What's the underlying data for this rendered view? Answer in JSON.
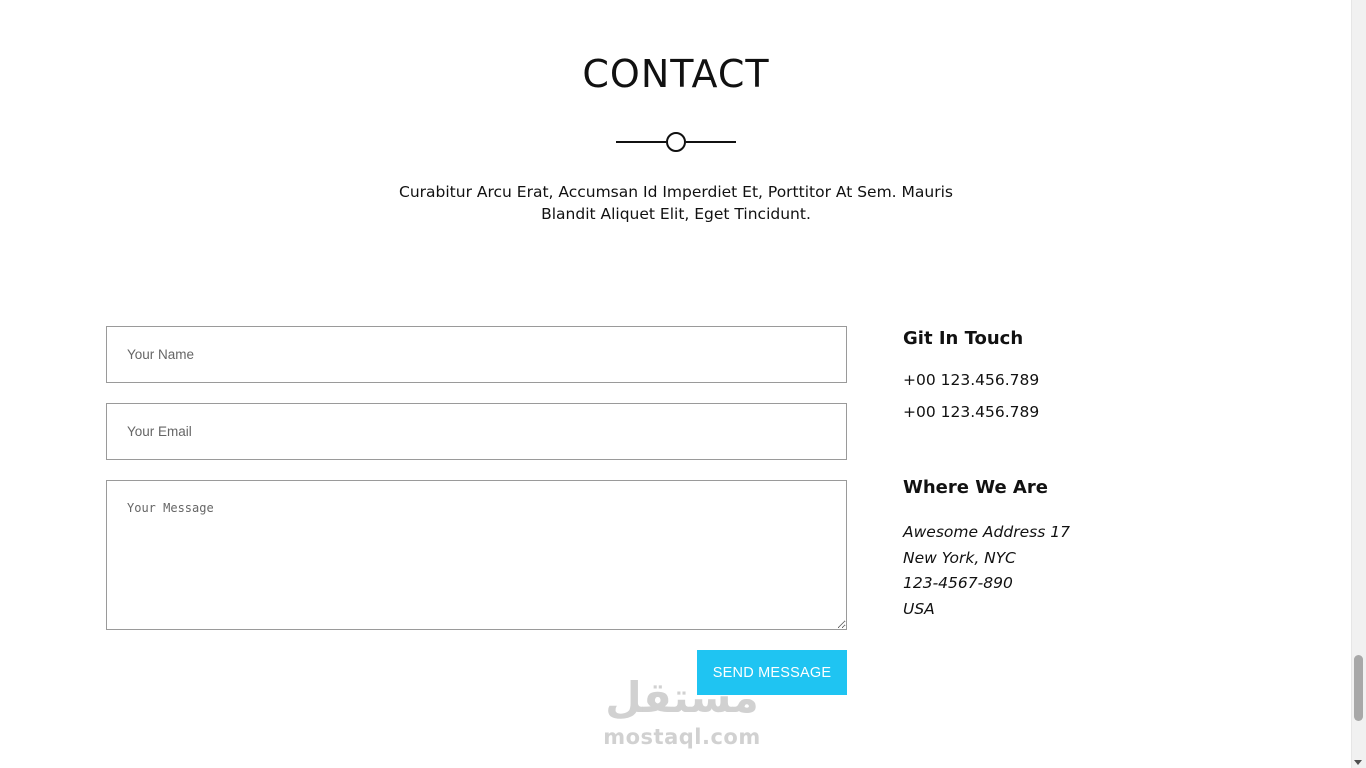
{
  "contact": {
    "title": "CONTACT",
    "intro": "Curabitur Arcu Erat, Accumsan Id Imperdiet Et, Porttitor At Sem. Mauris Blandit Aliquet Elit, Eget Tincidunt."
  },
  "form": {
    "name_placeholder": "Your Name",
    "email_placeholder": "Your Email",
    "message_placeholder": "Your Message",
    "send_label": "SEND MESSAGE",
    "button_color": "#1fc4f2"
  },
  "touch": {
    "heading": "Git In Touch",
    "phones": [
      "+00 123.456.789",
      "+00 123.456.789"
    ]
  },
  "where": {
    "heading": "Where We Are",
    "address_lines": [
      "Awesome Address 17",
      "New York, NYC",
      "123-4567-890",
      "USA"
    ]
  },
  "watermark": {
    "arabic": "مستقل",
    "latin": "mostaql.com"
  }
}
